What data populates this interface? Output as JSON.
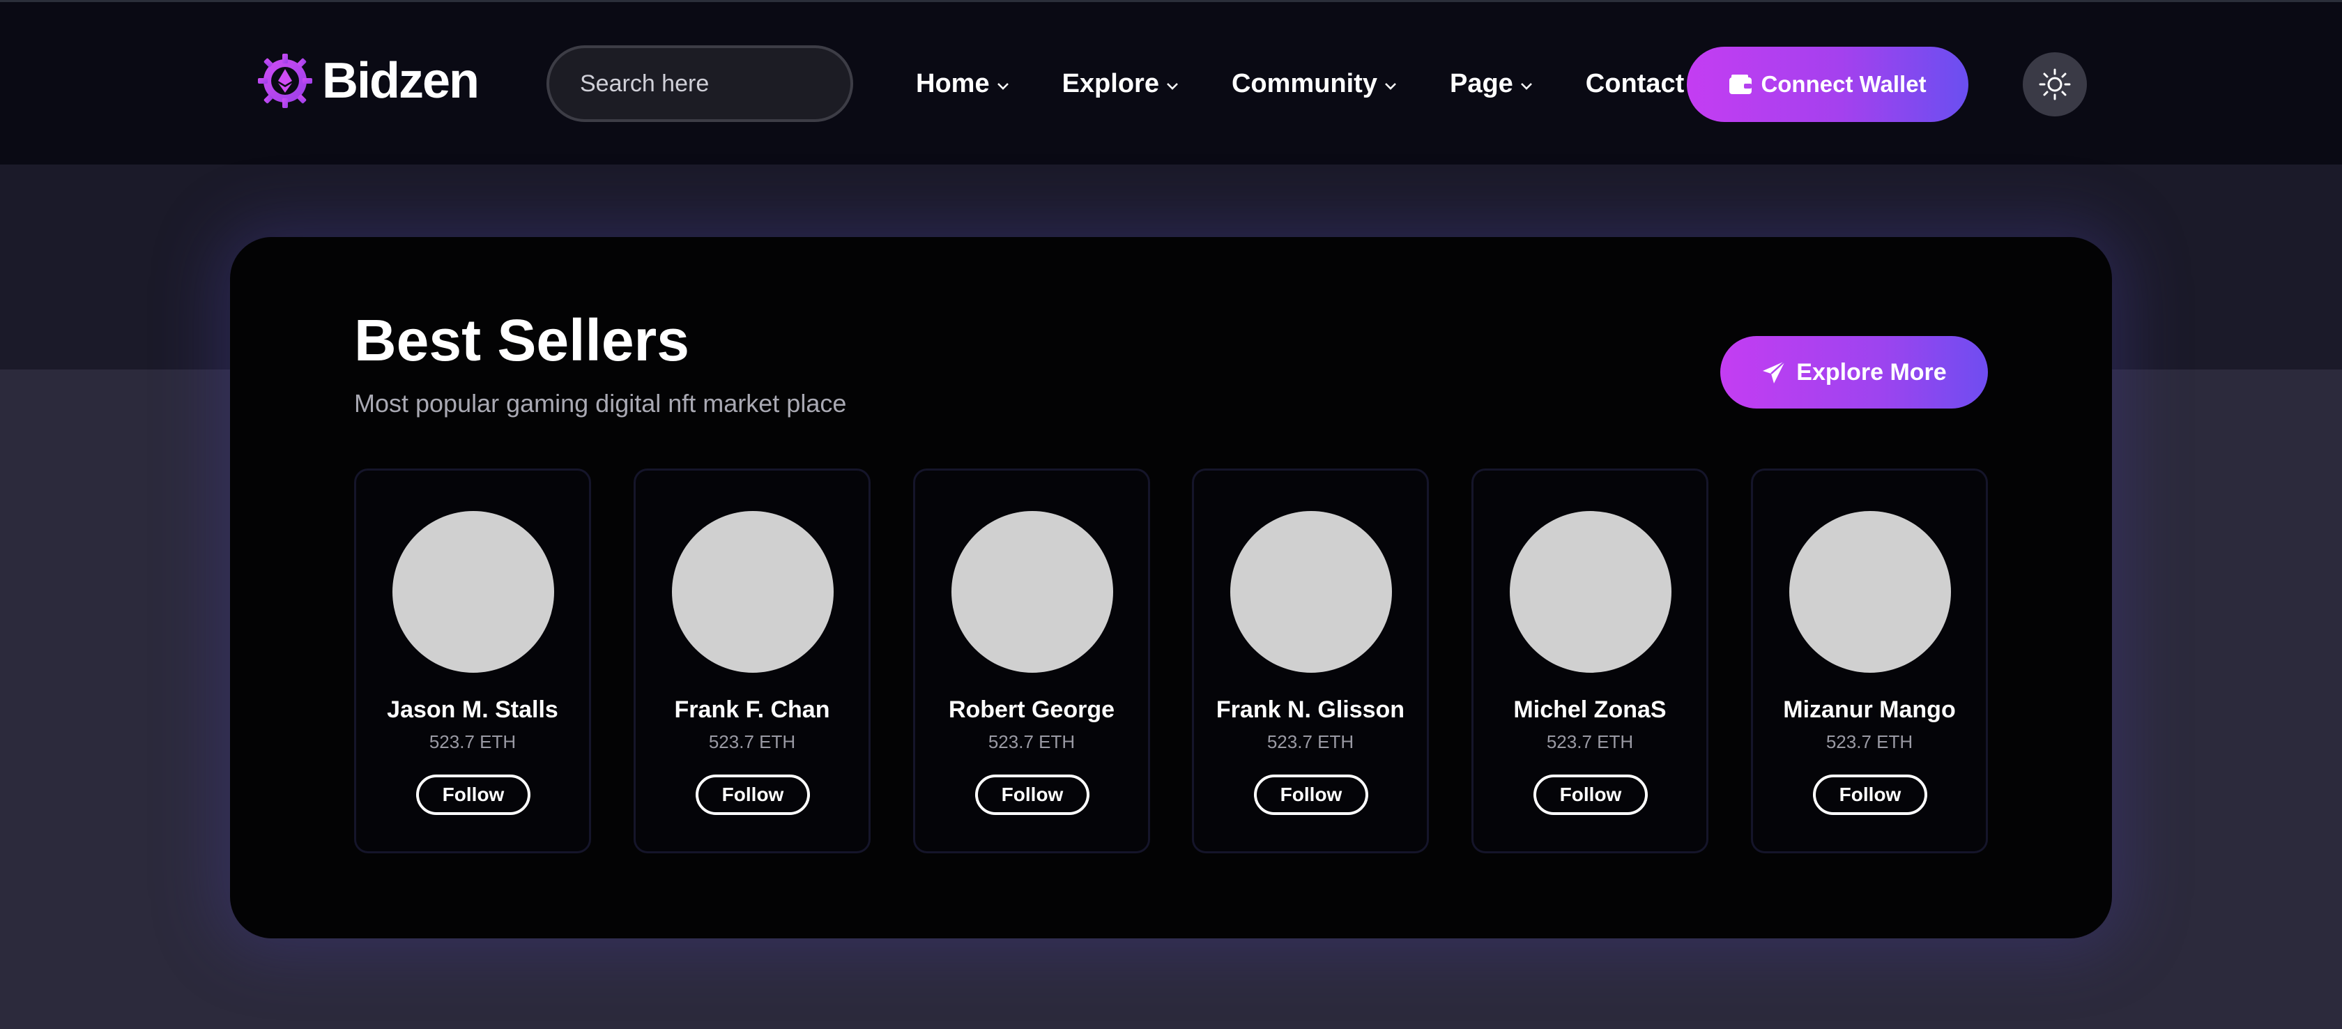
{
  "header": {
    "brand": "Bidzen",
    "search": {
      "placeholder": "Search here"
    },
    "nav": [
      {
        "label": "Home"
      },
      {
        "label": "Explore"
      },
      {
        "label": "Community"
      },
      {
        "label": "Page"
      },
      {
        "label": "Contact"
      }
    ],
    "connect_wallet_label": "Connect Wallet"
  },
  "best_sellers": {
    "title": "Best Sellers",
    "subtitle": "Most popular gaming digital nft market place",
    "explore_more_label": "Explore More",
    "sellers": [
      {
        "name": "Jason M. Stalls",
        "volume": "523.7 ETH",
        "follow_label": "Follow"
      },
      {
        "name": "Frank F. Chan",
        "volume": "523.7 ETH",
        "follow_label": "Follow"
      },
      {
        "name": "Robert George",
        "volume": "523.7 ETH",
        "follow_label": "Follow"
      },
      {
        "name": "Frank N. Glisson",
        "volume": "523.7 ETH",
        "follow_label": "Follow"
      },
      {
        "name": "Michel ZonaS",
        "volume": "523.7 ETH",
        "follow_label": "Follow"
      },
      {
        "name": "Mizanur Mango",
        "volume": "523.7 ETH",
        "follow_label": "Follow"
      }
    ]
  },
  "colors": {
    "accent_start": "#c43df2",
    "accent_end": "#6a4ff0",
    "header_bg": "#0a0a14",
    "card_bg": "#030304",
    "page_bg": "#2c2a3c"
  },
  "icons": {
    "logo": "ethereum-gear-logo-icon",
    "search": "search-icon",
    "chevron": "chevron-down-icon",
    "wallet": "wallet-icon",
    "theme": "sun-icon",
    "explore": "paper-plane-icon"
  }
}
